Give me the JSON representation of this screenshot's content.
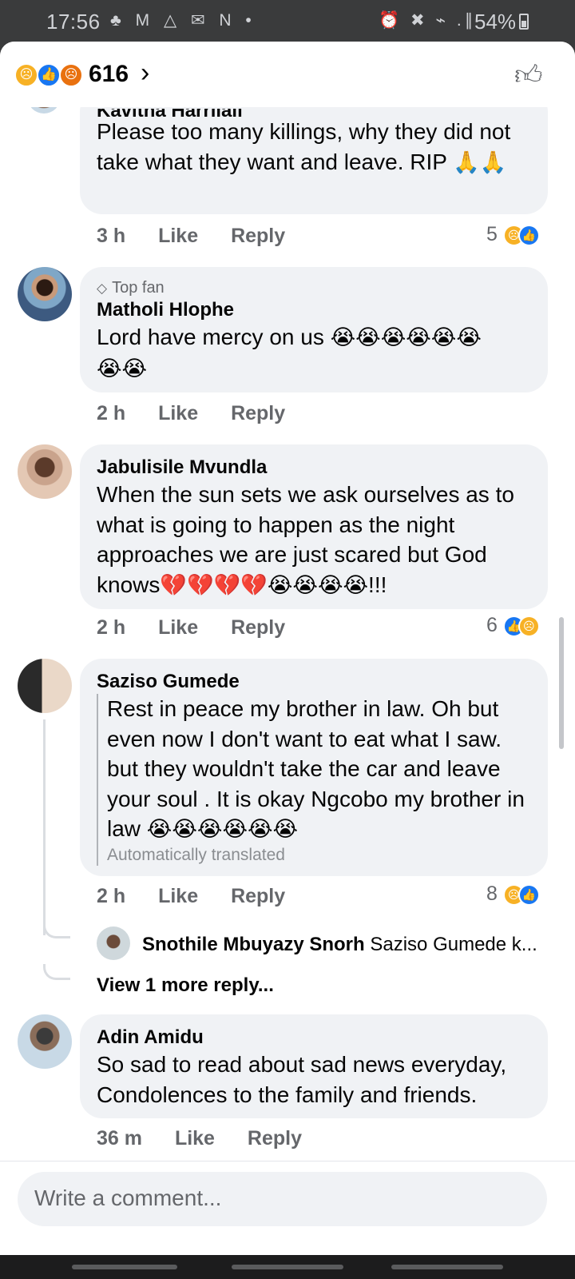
{
  "status": {
    "time": "17:56",
    "battery": "54%",
    "left_icons": "♣ M △ ✉ N •",
    "right_icons": "⏰ ✖ ⌁ .∥"
  },
  "header": {
    "reaction_count": "616",
    "reactions": [
      "sad-reaction",
      "like-reaction",
      "angry-reaction"
    ]
  },
  "comments": [
    {
      "author": "Kavitha Harrilall",
      "text": "Please too many killings, why they did not take what they want and leave. RIP",
      "emoji": "🙏🙏",
      "time": "3 h",
      "like_label": "Like",
      "reply_label": "Reply",
      "reaction_count": "5"
    },
    {
      "badge": "Top fan",
      "author": "Matholi Hlophe",
      "text": "Lord have mercy on us",
      "emoji_line1": "😭😭😭😭😭😭",
      "emoji_line2": "😭😭",
      "time": "2 h",
      "like_label": "Like",
      "reply_label": "Reply"
    },
    {
      "author": "Jabulisile Mvundla",
      "text": "When the sun sets we ask ourselves as to what is going to happen as the night approaches we are just scared but God knows",
      "emoji": "💔💔💔💔😭😭😭😭",
      "suffix": "!!!",
      "time": "2 h",
      "like_label": "Like",
      "reply_label": "Reply",
      "reaction_count": "6"
    },
    {
      "author": "Saziso Gumede",
      "text": "Rest in peace my brother in law. Oh but even now I don't want to eat what I saw. but they wouldn't take the car and leave your soul . It is okay Ngcobo my brother in law",
      "emoji": "😭😭😭😭😭😭",
      "translated_note": "Automatically translated",
      "time": "2 h",
      "like_label": "Like",
      "reply_label": "Reply",
      "reaction_count": "8",
      "reply_preview": {
        "author": "Snothile Mbuyazy Snorh",
        "text": "Saziso Gumede k..."
      },
      "view_more": "View 1 more reply..."
    },
    {
      "author": "Adin Amidu",
      "text": "So sad to read about sad news everyday, Condolences to the family and friends.",
      "time": "36 m",
      "like_label": "Like",
      "reply_label": "Reply"
    }
  ],
  "composer": {
    "placeholder": "Write a comment..."
  },
  "colors": {
    "bubble": "#f0f2f5",
    "meta_text": "#65676b",
    "like_blue": "#1877f2",
    "sad_yellow": "#f7b125",
    "angry_orange": "#e9710f"
  }
}
